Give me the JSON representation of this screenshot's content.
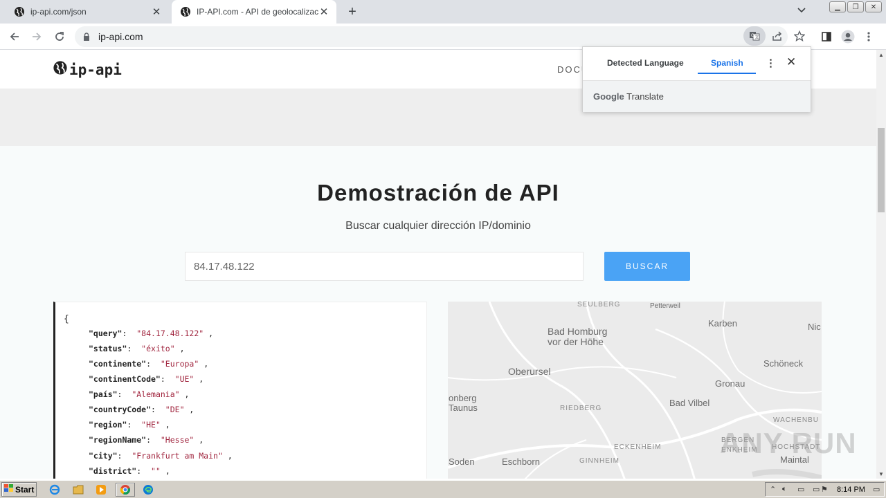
{
  "browser": {
    "tabs": [
      {
        "title": "ip-api.com/json",
        "active": false
      },
      {
        "title": "IP-API.com - API de geolocalización",
        "active": true
      }
    ],
    "url": "ip-api.com"
  },
  "site": {
    "logo_text": "ip-api",
    "nav_partial": "DOCU",
    "demo_title": "Demostración de API",
    "demo_subtitle": "Buscar cualquier dirección IP/dominio",
    "search_value": "84.17.48.122",
    "search_button": "BUSCAR",
    "json_open": "{",
    "json": [
      {
        "key": "\"query\"",
        "value": "\"84.17.48.122\""
      },
      {
        "key": "\"status\"",
        "value": "\"éxito\""
      },
      {
        "key": "\"continente\"",
        "value": "\"Europa\""
      },
      {
        "key": "\"continentCode\"",
        "value": "\"UE\""
      },
      {
        "key": "\"país\"",
        "value": "\"Alemania\""
      },
      {
        "key": "\"countryCode\"",
        "value": "\"DE\""
      },
      {
        "key": "\"region\"",
        "value": "\"HE\""
      },
      {
        "key": "\"regionName\"",
        "value": "\"Hesse\""
      },
      {
        "key": "\"city\"",
        "value": "\"Frankfurt am Main\""
      },
      {
        "key": "\"district\"",
        "value": "\"\""
      }
    ],
    "map_labels": [
      "SEULBERG",
      "Petterweil",
      "Bad Homburg\nvor der Höhe",
      "Karben",
      "Nic",
      "Oberursel",
      "Schöneck",
      "Gronau",
      "onberg\nTaunus",
      "RIEDBERG",
      "Bad Vilbel",
      "WACHENBU",
      "BERGEN",
      "ENKHEIM",
      "ECKENHEIM",
      "HOCHSTADT",
      "Maintal",
      "Soden",
      "Eschborn",
      "GINNHEIM"
    ]
  },
  "translate_popup": {
    "tab_detected": "Detected Language",
    "tab_target": "Spanish",
    "footer_brand": "Google",
    "footer_text": "Translate"
  },
  "watermark": "ANY RUN",
  "taskbar": {
    "start": "Start",
    "time": "8:14 PM"
  }
}
